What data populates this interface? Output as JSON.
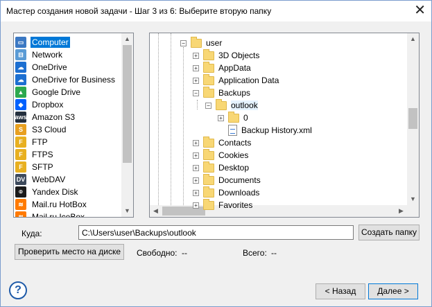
{
  "window": {
    "title": "Мастер создания новой задачи - Шаг 3 из 6: Выберите вторую папку",
    "close_glyph": "✕"
  },
  "locations": [
    {
      "label": "Computer",
      "icon": "computer-icon",
      "color": "#3b78c3",
      "glyph": "▭",
      "selected": true
    },
    {
      "label": "Network",
      "icon": "network-icon",
      "color": "#5a9bd5",
      "glyph": "⊟"
    },
    {
      "label": "OneDrive",
      "icon": "onedrive-icon",
      "color": "#1c6fd1",
      "glyph": "☁"
    },
    {
      "label": "OneDrive for Business",
      "icon": "onedrive-business-icon",
      "color": "#1c6fd1",
      "glyph": "☁"
    },
    {
      "label": "Google Drive",
      "icon": "google-drive-icon",
      "color": "#2da94f",
      "glyph": "▲"
    },
    {
      "label": "Dropbox",
      "icon": "dropbox-icon",
      "color": "#0061fe",
      "glyph": "◆"
    },
    {
      "label": "Amazon S3",
      "icon": "amazon-s3-icon",
      "color": "#232f3e",
      "glyph": "aws"
    },
    {
      "label": "S3 Cloud",
      "icon": "s3-cloud-icon",
      "color": "#e8a020",
      "glyph": "S"
    },
    {
      "label": "FTP",
      "icon": "ftp-icon",
      "color": "#e8b020",
      "glyph": "F"
    },
    {
      "label": "FTPS",
      "icon": "ftps-icon",
      "color": "#e8b020",
      "glyph": "F"
    },
    {
      "label": "SFTP",
      "icon": "sftp-icon",
      "color": "#e8b020",
      "glyph": "F"
    },
    {
      "label": "WebDAV",
      "icon": "webdav-icon",
      "color": "#3d4a5c",
      "glyph": "DV"
    },
    {
      "label": "Yandex Disk",
      "icon": "yandex-disk-icon",
      "color": "#1a1a1a",
      "glyph": "⌾"
    },
    {
      "label": "Mail.ru HotBox",
      "icon": "mailru-hotbox-icon",
      "color": "#ff7a00",
      "glyph": "≋"
    },
    {
      "label": "Mail.ru IceBox",
      "icon": "mailru-icebox-icon",
      "color": "#ff7a00",
      "glyph": "≋"
    }
  ],
  "tree": [
    {
      "label": "user",
      "depth": 0,
      "exp": "−",
      "type": "folder"
    },
    {
      "label": "3D Objects",
      "depth": 1,
      "exp": "+",
      "type": "folder"
    },
    {
      "label": "AppData",
      "depth": 1,
      "exp": "+",
      "type": "folder"
    },
    {
      "label": "Application Data",
      "depth": 1,
      "exp": "+",
      "type": "folder"
    },
    {
      "label": "Backups",
      "depth": 1,
      "exp": "−",
      "type": "folder"
    },
    {
      "label": "outlook",
      "depth": 2,
      "exp": "−",
      "type": "folder",
      "highlight": true
    },
    {
      "label": "0",
      "depth": 3,
      "exp": "+",
      "type": "folder"
    },
    {
      "label": "Backup History.xml",
      "depth": 3,
      "exp": "",
      "type": "file"
    },
    {
      "label": "Contacts",
      "depth": 1,
      "exp": "+",
      "type": "folder"
    },
    {
      "label": "Cookies",
      "depth": 1,
      "exp": "+",
      "type": "folder"
    },
    {
      "label": "Desktop",
      "depth": 1,
      "exp": "+",
      "type": "folder"
    },
    {
      "label": "Documents",
      "depth": 1,
      "exp": "+",
      "type": "folder"
    },
    {
      "label": "Downloads",
      "depth": 1,
      "exp": "+",
      "type": "folder"
    },
    {
      "label": "Favorites",
      "depth": 1,
      "exp": "+",
      "type": "folder"
    }
  ],
  "destination": {
    "label": "Куда:",
    "value": "C:\\Users\\user\\Backups\\outlook",
    "create_folder_button": "Создать папку"
  },
  "disk": {
    "check_button": "Проверить место на диске",
    "free_label": "Свободно:",
    "free_value": "--",
    "total_label": "Всего:",
    "total_value": "--"
  },
  "footer": {
    "help_glyph": "?",
    "back_button": "< Назад",
    "next_button": "Далее >"
  },
  "scroll_glyphs": {
    "up": "▲",
    "down": "▼",
    "left": "◀",
    "right": "▶"
  }
}
